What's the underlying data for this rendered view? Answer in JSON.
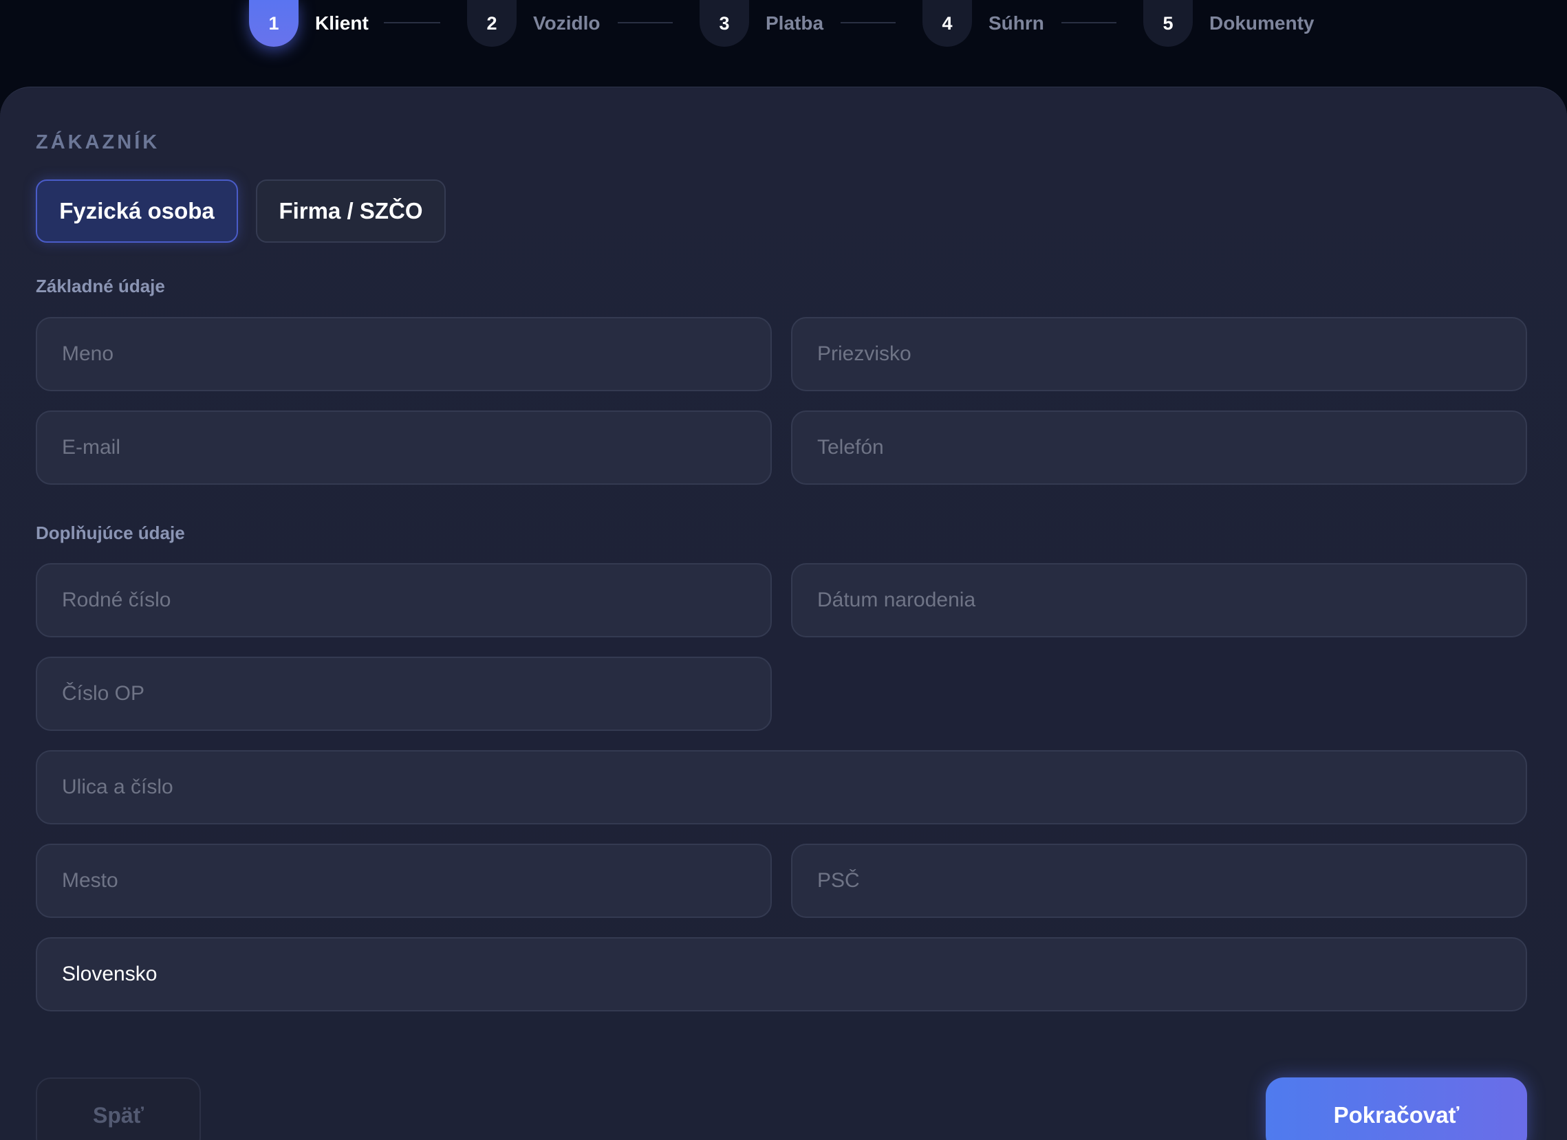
{
  "stepper": {
    "steps": [
      {
        "number": "1",
        "label": "Klient",
        "active": true
      },
      {
        "number": "2",
        "label": "Vozidlo",
        "active": false
      },
      {
        "number": "3",
        "label": "Platba",
        "active": false
      },
      {
        "number": "4",
        "label": "Súhrn",
        "active": false
      },
      {
        "number": "5",
        "label": "Dokumenty",
        "active": false
      }
    ]
  },
  "form": {
    "section_title": "ZÁKAZNÍK",
    "customer_types": [
      {
        "label": "Fyzická osoba",
        "selected": true
      },
      {
        "label": "Firma / SZČO",
        "selected": false
      }
    ],
    "basic_label": "Základné údaje",
    "first_name": {
      "placeholder": "Meno",
      "value": ""
    },
    "last_name": {
      "placeholder": "Priezvisko",
      "value": ""
    },
    "email": {
      "placeholder": "E-mail",
      "value": ""
    },
    "phone": {
      "placeholder": "Telefón",
      "value": ""
    },
    "extra_label": "Doplňujúce údaje",
    "birth_number": {
      "placeholder": "Rodné číslo",
      "value": ""
    },
    "birth_date": {
      "placeholder": "Dátum narodenia",
      "value": ""
    },
    "id_number": {
      "placeholder": "Číslo OP",
      "value": ""
    },
    "street": {
      "placeholder": "Ulica a číslo",
      "value": ""
    },
    "city": {
      "placeholder": "Mesto",
      "value": ""
    },
    "zip": {
      "placeholder": "PSČ",
      "value": ""
    },
    "country": {
      "value": "Slovensko"
    }
  },
  "actions": {
    "back_label": "Späť",
    "next_label": "Pokračovať"
  },
  "colors": {
    "accent": "#5a74f0",
    "background": "#050914",
    "card": "#1f2338"
  }
}
